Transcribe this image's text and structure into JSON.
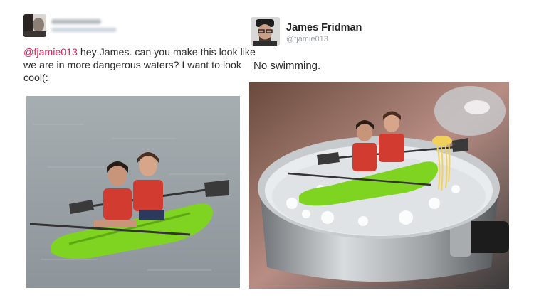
{
  "left_tweet": {
    "mention": "@fjamie013",
    "body": " hey James. can you make this look like we are in more dangerous waters? I want to look cool(:",
    "avatar_icon": "user-avatar-icon"
  },
  "right_tweet": {
    "name": "James Fridman",
    "handle": "@fjamie013",
    "text": "No swimming.",
    "avatar_icon": "user-avatar-icon"
  },
  "colors": {
    "mention": "#e0245e",
    "kayak": "#7fd321",
    "water": "#9aa1a6",
    "pot": "#b8bcbf"
  }
}
